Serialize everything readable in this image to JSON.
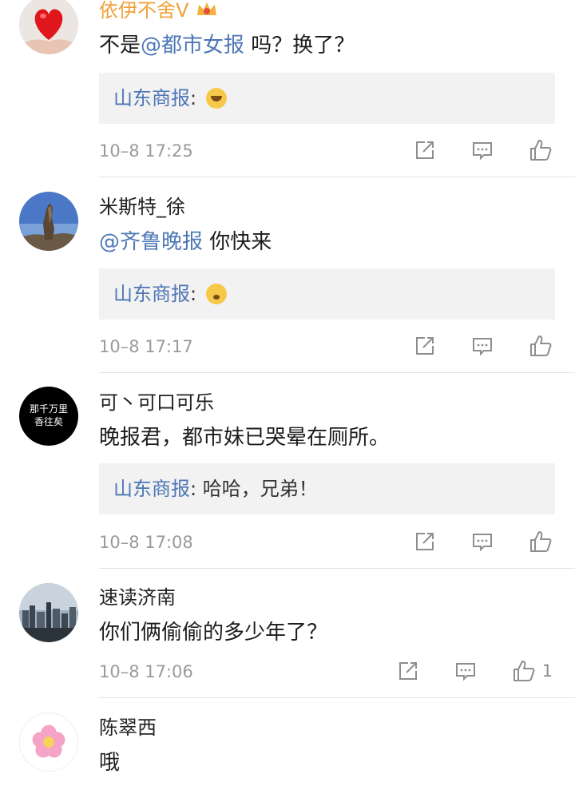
{
  "comments": [
    {
      "username": "依伊不舍V",
      "text_before": "不是",
      "mention": "@都市女报",
      "text_after": " 吗？换了？",
      "reply_name": "山东商报",
      "reply_text": "",
      "time": "10–8 17:25",
      "likes": ""
    },
    {
      "username": "米斯特_徐",
      "text_before": "",
      "mention": "@齐鲁晚报",
      "text_after": " 你快来",
      "reply_name": "山东商报",
      "reply_text": "",
      "time": "10–8 17:17",
      "likes": ""
    },
    {
      "username": "可丶可口可乐",
      "text_before": "晚报君，都市妹已哭晕在厕所。",
      "mention": "",
      "text_after": "",
      "reply_name": "山东商报",
      "reply_text": "哈哈，兄弟！",
      "time": "10–8 17:08",
      "likes": ""
    },
    {
      "username": "速读济南",
      "text_before": "你们俩偷偷的多少年了？",
      "mention": "",
      "text_after": "",
      "time": "10–8 17:06",
      "likes": "1"
    },
    {
      "username": "陈翠西",
      "text_before": "哦",
      "mention": "",
      "text_after": ""
    }
  ],
  "reply_sep": ": ",
  "avatar_text": "那千万里",
  "avatar_text2": "香往矣",
  "colors": {
    "link": "#4e77b6",
    "reply_bg": "#f2f2f2",
    "time": "#9a9a9a",
    "vip": "#f0a13a"
  }
}
